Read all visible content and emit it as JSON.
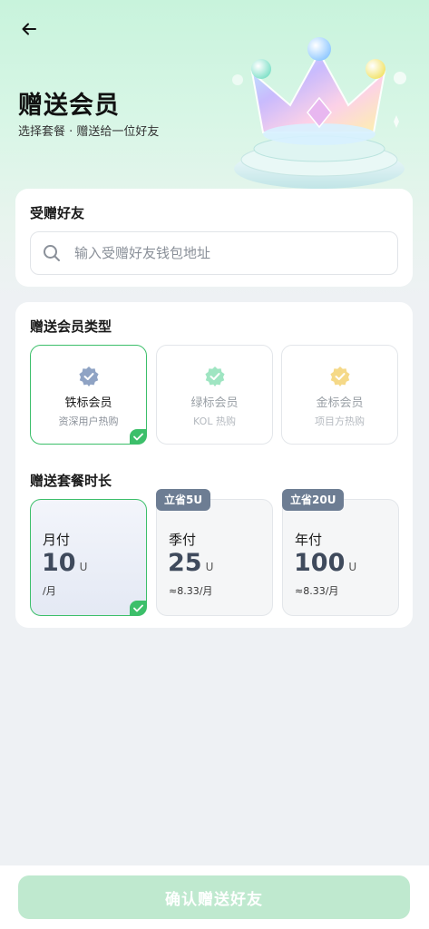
{
  "header": {
    "title": "赠送会员",
    "subtitle": "选择套餐 · 赠送给一位好友"
  },
  "friend_section": {
    "title": "受赠好友",
    "placeholder": "输入受赠好友钱包地址",
    "value": ""
  },
  "member_section": {
    "title": "赠送会员类型",
    "options": [
      {
        "name": "铁标会员",
        "desc": "资深用户热购",
        "badge_color": "#8fa3c4",
        "selected": true
      },
      {
        "name": "绿标会员",
        "desc": "KOL 热购",
        "badge_color": "#7fdcae",
        "selected": false
      },
      {
        "name": "金标会员",
        "desc": "项目方热购",
        "badge_color": "#f3d06a",
        "selected": false
      }
    ]
  },
  "plan_section": {
    "title": "赠送套餐时长",
    "plans": [
      {
        "name": "月付",
        "price": "10",
        "unit": "U",
        "per": "/月",
        "tag": "",
        "selected": true
      },
      {
        "name": "季付",
        "price": "25",
        "unit": "U",
        "per": "≈8.33/月",
        "tag": "立省5U",
        "selected": false
      },
      {
        "name": "年付",
        "price": "100",
        "unit": "U",
        "per": "≈8.33/月",
        "tag": "立省20U",
        "selected": false
      }
    ]
  },
  "footer": {
    "confirm_label": "确认赠送好友"
  },
  "colors": {
    "accent": "#3cbf6a",
    "button_disabled": "#bfe9cf",
    "tag_bg": "#6d7d93"
  }
}
